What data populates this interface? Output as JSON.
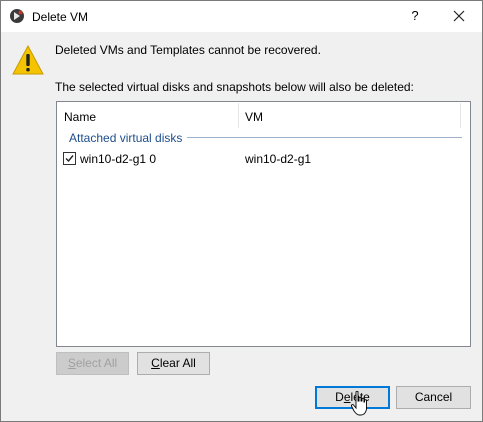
{
  "window": {
    "title": "Delete VM",
    "help_label": "?"
  },
  "messages": {
    "warning": "Deleted VMs and Templates cannot be recovered.",
    "info": "The selected virtual disks and snapshots below will also be deleted:"
  },
  "disk_list": {
    "columns": [
      "Name",
      "VM"
    ],
    "groups": [
      {
        "label": "Attached virtual disks",
        "rows": [
          {
            "checked": true,
            "name": "win10-d2-g1 0",
            "vm": "win10-d2-g1"
          }
        ]
      }
    ]
  },
  "buttons": {
    "select_all": {
      "label_underlined": "S",
      "label_rest": "elect All",
      "enabled": false
    },
    "clear_all": {
      "label_underlined": "C",
      "label_rest": "lear All",
      "enabled": true
    },
    "delete": {
      "label_before": "D",
      "label_underlined": "e",
      "label_rest": "lete"
    },
    "cancel": {
      "label": "Cancel"
    }
  },
  "colors": {
    "group_label": "#1e4e8c",
    "dialog_bg": "#f0f0f0",
    "default_button_border": "#0078d7",
    "warning_yellow": "#f5c400"
  }
}
